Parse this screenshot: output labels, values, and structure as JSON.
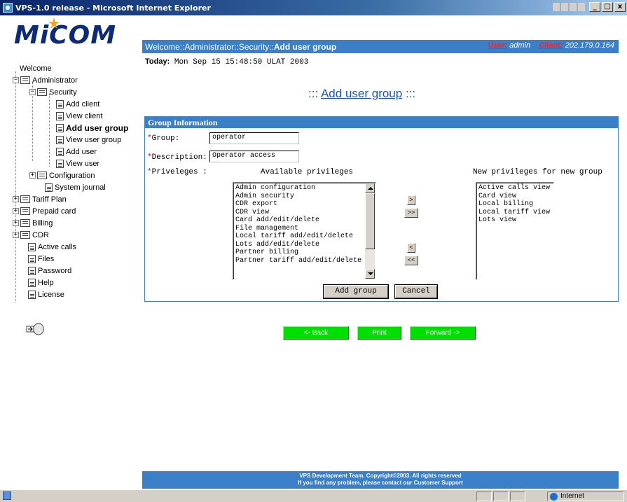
{
  "window": {
    "title": "VPS-1.0 release - Microsoft Internet Explorer",
    "controls": [
      "_",
      "□",
      "x"
    ]
  },
  "logo": {
    "text": "MiCOM"
  },
  "tree": {
    "welcome": "Welcome",
    "administrator": "Administrator",
    "security": "Security",
    "add_client": "Add client",
    "view_client": "View client",
    "add_user_group": "Add user group",
    "view_user_group": "View user group",
    "add_user": "Add user",
    "view_user": "View user",
    "configuration": "Configuration",
    "system_journal": "System journal",
    "tariff_plan": "Tariff Plan",
    "prepaid_card": "Prepaid card",
    "billing": "Billing",
    "cdr": "CDR",
    "active_calls": "Active calls",
    "files": "Files",
    "password": "Password",
    "help": "Help",
    "license": "License"
  },
  "header": {
    "breadcrumb_prefix": "Welcome::Administrator::Security::",
    "breadcrumb_current": "Add user group",
    "user_label": "User:",
    "user_value": "admin",
    "client_label": "Client:",
    "client_value": "202.179.0.164"
  },
  "today": {
    "label": "Today:",
    "value": "Mon Sep 15 15:48:50 ULAT 2003"
  },
  "page_title": {
    "prefix": ":::",
    "text": "Add user group",
    "suffix": ":::"
  },
  "group_panel": {
    "title": "Group Information",
    "group_label": "Group:",
    "group_value": "operator",
    "description_label": "Description:",
    "description_value": "Operator access",
    "privileges_label": "Priveleges :",
    "available_header": "Available privileges",
    "new_header": "New privileges for new group",
    "available": [
      "Admin configuration",
      "Admin security",
      "CDR export",
      "CDR view",
      "Card add/edit/delete",
      "File management",
      "Local tariff add/edit/delete",
      "Lots add/edit/delete",
      "Partner billing",
      "Partner tariff add/edit/delete"
    ],
    "selected": [
      "Active calls view",
      "Card view",
      "Local billing",
      "Local tariff view",
      "Lots view"
    ],
    "move_right": ">",
    "move_all_right": ">>",
    "move_left": "<",
    "move_all_left": "<<",
    "add_button": "Add group",
    "cancel_button": "Cancel"
  },
  "nav": {
    "back": "<- Back",
    "print": "Print",
    "forward": "Forward ->"
  },
  "footer": {
    "line1": "VPS Development Team. Copyright©2003. All rights reserved",
    "line2": "If you find any problem, please contact our Customer Support"
  },
  "status": {
    "zone": "Internet"
  },
  "colors": {
    "header_blue": "#3a7fc8",
    "nav_green": "#00e000",
    "required_red": "#dd0000"
  }
}
